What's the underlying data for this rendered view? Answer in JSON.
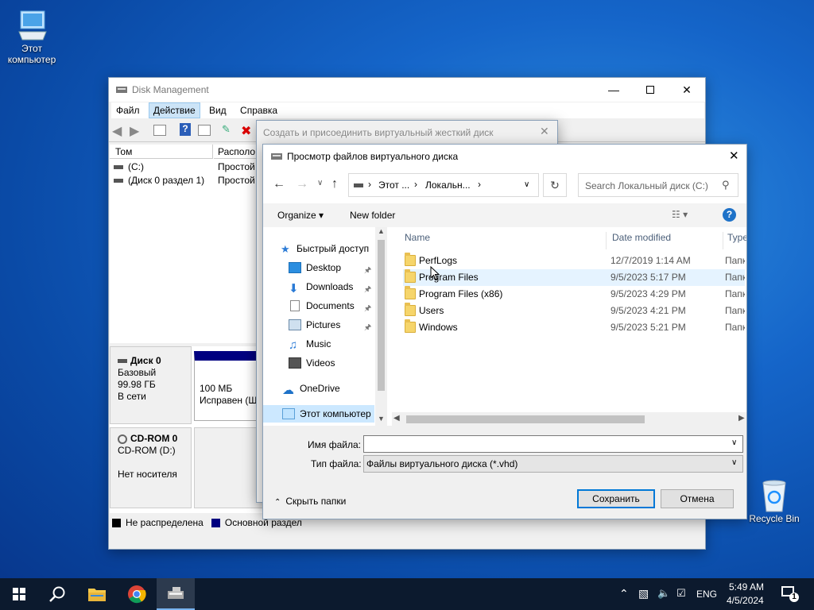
{
  "desktop": {
    "this_pc_label": "Этот компьютер",
    "recycle_bin_label": "Recycle Bin"
  },
  "disk_mgmt": {
    "title": "Disk Management",
    "menu": [
      "Файл",
      "Действие",
      "Вид",
      "Справка"
    ],
    "col_volume": "Том",
    "col_layout": "Располо...",
    "volumes": [
      {
        "name": "(C:)",
        "layout": "Простой"
      },
      {
        "name": "(Диск 0 раздел 1)",
        "layout": "Простой"
      }
    ],
    "disk0": {
      "name": "Диск 0",
      "type": "Базовый",
      "size": "99.98 ГБ",
      "status": "В сети"
    },
    "partition": {
      "size": "100 МБ",
      "status": "Исправен (Ш"
    },
    "cdrom": {
      "name": "CD-ROM 0",
      "drive": "CD-ROM (D:)",
      "status": "Нет носителя"
    },
    "legend": [
      {
        "label": "Не распределена",
        "color": "#000000"
      },
      {
        "label": "Основной раздел",
        "color": "#000080"
      }
    ]
  },
  "vhd_dialog": {
    "title": "Создать и присоединить виртуальный жесткий диск"
  },
  "file_dialog": {
    "title": "Просмотр файлов виртуального диска",
    "breadcrumb": [
      "Этот ...",
      "Локальн..."
    ],
    "search_placeholder": "Search Локальный диск (C:)",
    "organize_label": "Organize",
    "new_folder_label": "New folder",
    "nav": {
      "quick_access": "Быстрый доступ",
      "items": [
        "Desktop",
        "Downloads",
        "Documents",
        "Pictures",
        "Music",
        "Videos"
      ],
      "onedrive": "OneDrive",
      "this_pc": "Этот компьютер"
    },
    "columns": {
      "name": "Name",
      "date": "Date modified",
      "type": "Type"
    },
    "files": [
      {
        "name": "PerfLogs",
        "date": "12/7/2019 1:14 AM",
        "type": "Папка"
      },
      {
        "name": "Program Files",
        "date": "9/5/2023 5:17 PM",
        "type": "Папка"
      },
      {
        "name": "Program Files (x86)",
        "date": "9/5/2023 4:29 PM",
        "type": "Папка"
      },
      {
        "name": "Users",
        "date": "9/5/2023 4:21 PM",
        "type": "Папка"
      },
      {
        "name": "Windows",
        "date": "9/5/2023 5:21 PM",
        "type": "Папка"
      }
    ],
    "filename_label": "Имя файла:",
    "filename_value": "",
    "filetype_label": "Тип файла:",
    "filetype_value": "Файлы виртуального диска (*.vhd)",
    "hide_folders_label": "Скрыть папки",
    "save_label": "Сохранить",
    "cancel_label": "Отмена"
  },
  "taskbar": {
    "language": "ENG",
    "time": "5:49 AM",
    "date": "4/5/2024",
    "notifications_count": "1"
  }
}
